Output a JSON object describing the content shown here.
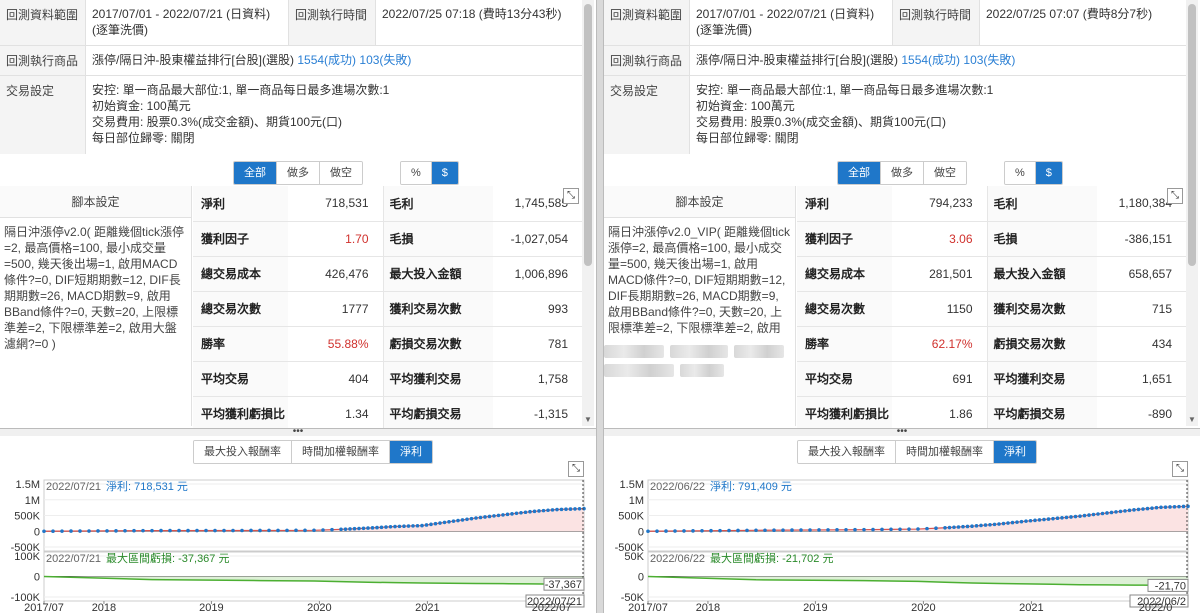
{
  "labels": {
    "period": "回測資料範圍",
    "exec_time": "回測執行時間",
    "product": "回測執行商品",
    "settings": "交易設定",
    "script": "腳本設定"
  },
  "buttons": {
    "filter": [
      "全部",
      "做多",
      "做空"
    ],
    "unit": [
      "%",
      "$"
    ],
    "chart_tabs": [
      "最大投入報酬率",
      "時間加權報酬率",
      "淨利"
    ]
  },
  "panes": [
    {
      "period": [
        "2017/07/01 - 2022/07/21 (日資料)",
        "(逐筆洗價)"
      ],
      "exec_time": "2022/07/25 07:18 (費時13分43秒)",
      "product_name": "漲停/隔日沖-股東權益排行[台股](選股)",
      "success": "1554(成功)",
      "fail": "103(失敗)",
      "settings": [
        "安控: 單一商品最大部位:1, 單一商品每日最多進場次數:1",
        "初始資金: 100萬元",
        "交易費用: 股票0.3%(成交金額)、期貨100元(口)",
        "每日部位歸零: 關閉"
      ],
      "script_text": "隔日沖漲停v2.0( 距離幾個tick漲停=2, 最高價格=100, 最小成交量=500, 幾天後出場=1, 啟用MACD條件?=0, DIF短期期數=12, DIF長期期數=26, MACD期數=9, 啟用BBand條件?=0, 天數=20, 上限標準差=2, 下限標準差=2, 啟用大盤濾網?=0 )",
      "stats": [
        [
          "淨利",
          "718,531",
          "毛利",
          "1,745,585"
        ],
        [
          "獲利因子",
          "1.70",
          "毛損",
          "-1,027,054"
        ],
        [
          "總交易成本",
          "426,476",
          "最大投入金額",
          "1,006,896"
        ],
        [
          "總交易次數",
          "1777",
          "獲利交易次數",
          "993"
        ],
        [
          "勝率",
          "55.88%",
          "虧損交易次數",
          "781"
        ],
        [
          "平均交易",
          "404",
          "平均獲利交易",
          "1,758"
        ],
        [
          "平均獲利虧損比",
          "1.34",
          "平均虧損交易",
          "-1,315"
        ]
      ],
      "chart_data": {
        "type": "area",
        "date": "2022/07/21",
        "net_label": "淨利: 718,531 元",
        "dd_label": "最大區間虧損: -37,367 元",
        "dd_value_label": "-37,367",
        "date_flag": "2022/07/21",
        "yticks_top": [
          "1.5M",
          "1M",
          "500K",
          "0",
          "-500K"
        ],
        "yticks_bottom": [
          "100K",
          "0",
          "-100K"
        ],
        "xticks": [
          "2017/07",
          "2018",
          "2019",
          "2020",
          "2021",
          "2022/07"
        ],
        "x": [
          0,
          0.2,
          0.4,
          0.5,
          0.55,
          0.6,
          0.65,
          0.7,
          0.75,
          0.8,
          0.85,
          0.9,
          0.95,
          1.0
        ],
        "net": [
          0,
          20000,
          25000,
          30000,
          60000,
          100000,
          150000,
          180000,
          300000,
          420000,
          520000,
          620000,
          690000,
          718531
        ],
        "dd": [
          0,
          -15000,
          -20000,
          -22000,
          -25000,
          -28000,
          -30000,
          -32000,
          -33000,
          -34000,
          -35000,
          -36000,
          -37000,
          -37367
        ],
        "ylim": [
          -500000,
          1500000
        ],
        "dd_ylim": [
          -100000,
          100000
        ],
        "colors": {
          "line": "#d9534f",
          "marker": "#1f77c9",
          "fill": "#fbe3e3",
          "dd": "#4caf32",
          "dd_fill": "#ddf0d6"
        }
      }
    },
    {
      "period": [
        "2017/07/01 - 2022/07/21 (日資料)",
        "(逐筆洗價)"
      ],
      "exec_time": "2022/07/25 07:07 (費時8分7秒)",
      "product_name": "漲停/隔日沖-股東權益排行[台股](選股)",
      "success": "1554(成功)",
      "fail": "103(失敗)",
      "settings": [
        "安控: 單一商品最大部位:1, 單一商品每日最多進場次數:1",
        "初始資金: 100萬元",
        "交易費用: 股票0.3%(成交金額)、期貨100元(口)",
        "每日部位歸零: 關閉"
      ],
      "script_text": "隔日沖漲停v2.0_VIP( 距離幾個tick漲停=2, 最高價格=100, 最小成交量=500, 幾天後出場=1, 啟用MACD條件?=0, DIF短期期數=12, DIF長期期數=26, MACD期數=9, 啟用BBand條件?=0, 天數=20, 上限標準差=2, 下限標準差=2, 啟用",
      "stats": [
        [
          "淨利",
          "794,233",
          "毛利",
          "1,180,384"
        ],
        [
          "獲利因子",
          "3.06",
          "毛損",
          "-386,151"
        ],
        [
          "總交易成本",
          "281,501",
          "最大投入金額",
          "658,657"
        ],
        [
          "總交易次數",
          "1150",
          "獲利交易次數",
          "715"
        ],
        [
          "勝率",
          "62.17%",
          "虧損交易次數",
          "434"
        ],
        [
          "平均交易",
          "691",
          "平均獲利交易",
          "1,651"
        ],
        [
          "平均獲利虧損比",
          "1.86",
          "平均虧損交易",
          "-890"
        ]
      ],
      "chart_data": {
        "type": "area",
        "date": "2022/06/22",
        "net_label": "淨利: 791,409 元",
        "dd_label": "最大區間虧損: -21,702 元",
        "dd_value_label": "-21,70",
        "date_flag": "2022/06/2",
        "yticks_top": [
          "1.5M",
          "1M",
          "500K",
          "0",
          "-500K"
        ],
        "yticks_bottom": [
          "50K",
          "0",
          "-50K"
        ],
        "xticks": [
          "2017/07",
          "2018",
          "2019",
          "2020",
          "2021",
          "2022/0"
        ],
        "x": [
          0,
          0.2,
          0.4,
          0.5,
          0.55,
          0.6,
          0.65,
          0.7,
          0.75,
          0.8,
          0.85,
          0.9,
          0.95,
          1.0
        ],
        "net": [
          0,
          30000,
          50000,
          70000,
          110000,
          160000,
          230000,
          320000,
          400000,
          480000,
          580000,
          680000,
          760000,
          791409
        ],
        "dd": [
          0,
          -8000,
          -10000,
          -12000,
          -14000,
          -16000,
          -17000,
          -18000,
          -19000,
          -20000,
          -20500,
          -21000,
          -21500,
          -21702
        ],
        "ylim": [
          -500000,
          1500000
        ],
        "dd_ylim": [
          -50000,
          50000
        ],
        "colors": {
          "line": "#d9534f",
          "marker": "#1f77c9",
          "fill": "#fbe3e3",
          "dd": "#4caf32",
          "dd_fill": "#ddf0d6"
        }
      }
    }
  ]
}
